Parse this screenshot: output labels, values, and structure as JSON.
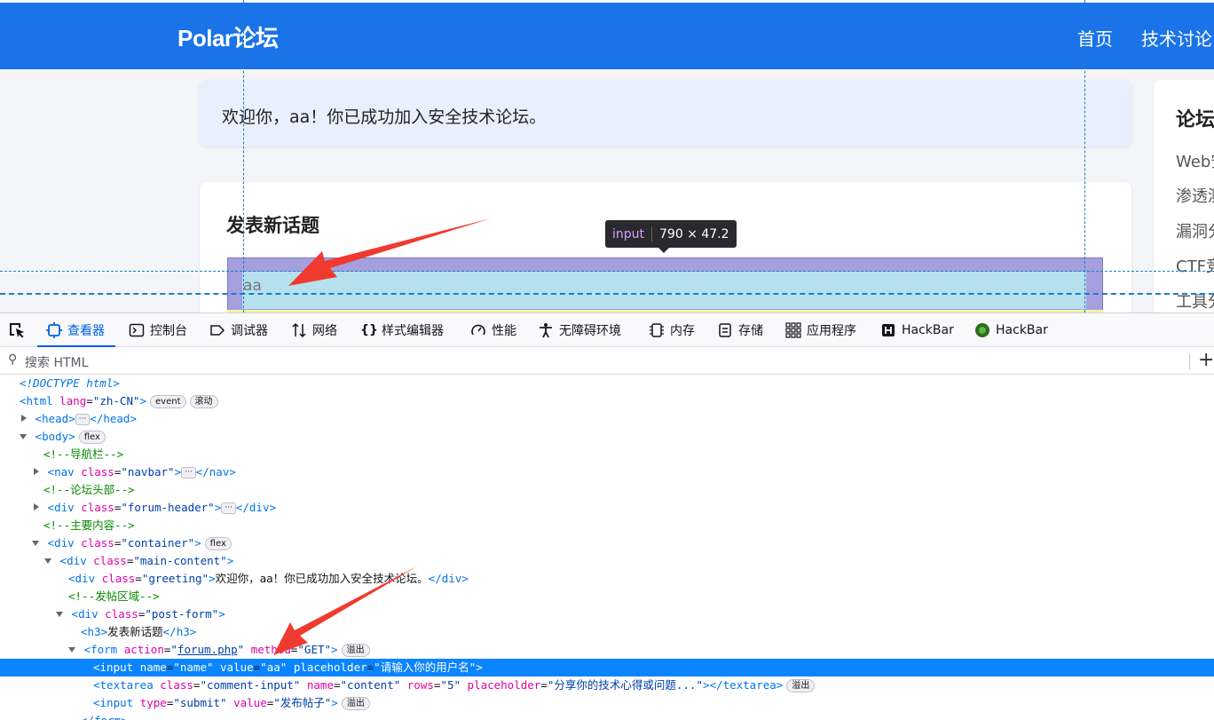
{
  "page": {
    "brand": "Polar论坛",
    "nav": [
      "首页",
      "技术讨论"
    ],
    "greeting": "欢迎你，aa！你已成功加入安全技术论坛。",
    "post_form_title": "发表新话题",
    "input_value": "aa",
    "sidebar": {
      "title": "论坛",
      "items": [
        "Web安",
        "渗透测",
        "漏洞分",
        "CTF竞",
        "工具分"
      ]
    },
    "tooltip": {
      "tag": "input",
      "size": "790 × 47.2"
    }
  },
  "devtools": {
    "tabs": [
      {
        "label": "查看器",
        "icon": "inspector-icon"
      },
      {
        "label": "控制台",
        "icon": "console-icon"
      },
      {
        "label": "调试器",
        "icon": "debugger-icon"
      },
      {
        "label": "网络",
        "icon": "network-icon"
      },
      {
        "label": "样式编辑器",
        "icon": "style-editor-icon"
      },
      {
        "label": "性能",
        "icon": "performance-icon"
      },
      {
        "label": "无障碍环境",
        "icon": "accessibility-icon"
      },
      {
        "label": "内存",
        "icon": "memory-icon"
      },
      {
        "label": "存储",
        "icon": "storage-icon"
      },
      {
        "label": "应用程序",
        "icon": "application-icon"
      },
      {
        "label": "HackBar",
        "icon": "hackbar-icon"
      },
      {
        "label": "HackBar",
        "icon": "hackbar-green-icon"
      }
    ],
    "search_placeholder": "搜索 HTML",
    "badges": {
      "event": "event",
      "scroll": "滚动",
      "flex": "flex",
      "overflow": "溢出"
    },
    "tree": {
      "doctype": "<!DOCTYPE html>",
      "html_tag": "html",
      "lang_attr": "lang",
      "lang_val": "\"zh-CN\"",
      "head": "head",
      "body": "body",
      "c_nav": "<!--导航栏-->",
      "nav": "nav",
      "class_attr": "class",
      "nav_cls": "\"navbar\"",
      "c_header": "<!--论坛头部-->",
      "div": "div",
      "header_cls": "\"forum-header\"",
      "c_main": "<!--主要内容-->",
      "container_cls": "\"container\"",
      "main_cls": "\"main-content\"",
      "greeting_cls": "\"greeting\"",
      "greeting_text": "欢迎你，aa！你已成功加入安全技术论坛。",
      "c_post": "<!--发帖区域-->",
      "post_cls": "\"post-form\"",
      "h3": "h3",
      "h3_text": "发表新话题",
      "form": "form",
      "action_attr": "action",
      "action_val": "forum.php",
      "method_attr": "method",
      "method_val": "\"GET\"",
      "input": "input",
      "name_attr": "name",
      "name_val": "\"name\"",
      "value_attr": "value",
      "value_val": "\"aa\"",
      "placeholder_attr": "placeholder",
      "placeholder_val": "\"请输入你的用户名\"",
      "textarea": "textarea",
      "textarea_cls": "\"comment-input\"",
      "content_val": "\"content\"",
      "rows_attr": "rows",
      "rows_val": "\"5\"",
      "textarea_ph": "\"分享你的技术心得或问题...\"",
      "type_attr": "type",
      "type_val": "\"submit\"",
      "submit_val": "\"发布帖子\""
    }
  }
}
